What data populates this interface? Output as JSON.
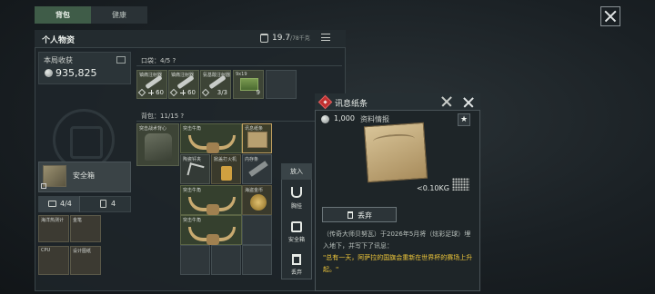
{
  "tabs": [
    {
      "label": "背包"
    },
    {
      "label": "健康"
    }
  ],
  "panel": {
    "title": "个人物资",
    "weight_value": "19.7",
    "weight_max": "/78千克"
  },
  "earnings": {
    "label": "本局收获",
    "value": "935,825"
  },
  "safe_box": {
    "label": "安全箱"
  },
  "slots": {
    "a": "4/4",
    "b": "4"
  },
  "side_items": [
    {
      "name": "海洋热测计"
    },
    {
      "name": "金笔"
    },
    {
      "name": "CPU"
    },
    {
      "name": "设计图纸"
    }
  ],
  "pocket": {
    "label": "口袋：4/5",
    "hint": "?",
    "items": [
      {
        "name": "镇痛注射器",
        "count": "60"
      },
      {
        "name": "镇痛注射器",
        "count": "60"
      },
      {
        "name": "氨基酸注射器",
        "count": "3/3"
      },
      {
        "name": "9x19",
        "count": "9"
      }
    ]
  },
  "backpack": {
    "label": "背包：11/15",
    "hint": "?",
    "vest_name": "突击战术背心",
    "items": [
      {
        "name": "突击牛角"
      },
      {
        "name": "讯息纸条"
      },
      {
        "name": "陶瓷钎夹"
      },
      {
        "name": "掀盖打火机"
      },
      {
        "name": "内存条"
      },
      {
        "name": "突击牛角"
      },
      {
        "name": "海盗金币"
      },
      {
        "name": "突击牛角"
      }
    ]
  },
  "context_menu": {
    "put": "放入",
    "chest": "胸挂",
    "safe": "安全箱",
    "discard": "丢弃"
  },
  "detail": {
    "title": "讯息纸条",
    "price": "1,000",
    "type": "资料情报",
    "star": "★",
    "weight": "<0.10KG",
    "discard_label": "丢弃",
    "description": "（传奇大师贝努瓦）于2026年5月将（炫彩足球）埋入地下，并写下了讯息：",
    "quote": "\"总有一天，阿萨拉的国旗会重新在世界杯的赛场上升起。\""
  },
  "colors": {
    "accent_green": "#3f5c48",
    "quote_gold": "#f0c83a",
    "alert_red": "#c03030"
  }
}
